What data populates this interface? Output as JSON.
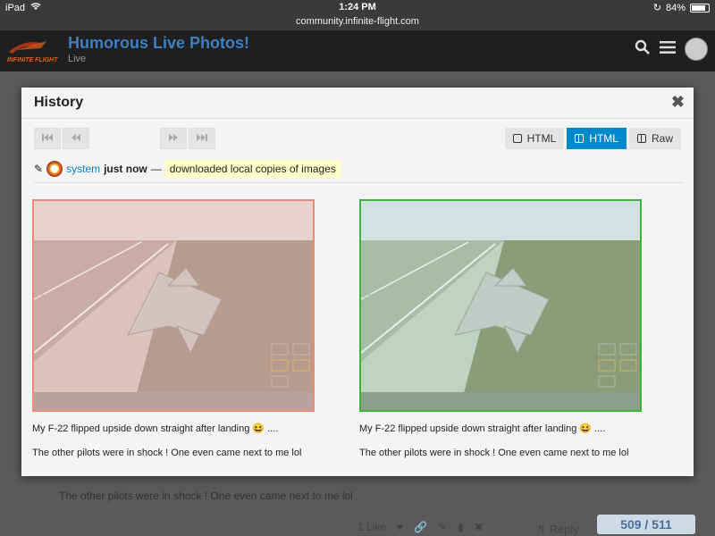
{
  "status_bar": {
    "device": "iPad",
    "time": "1:24 PM",
    "battery": "84%",
    "battery_level": 0.84
  },
  "url": "community.infinite-flight.com",
  "forum": {
    "logo_text": "INFINITE FLIGHT",
    "title": "Humorous Live Photos!",
    "category": "Live"
  },
  "background_post": {
    "text": "The other pilots were in shock ! One even came next to me lol",
    "like_label": "1 Like",
    "reply_label": "Reply",
    "counter": "509 / 511"
  },
  "modal": {
    "title": "History",
    "view_buttons": [
      {
        "label": "HTML",
        "icon": "single-pane-icon",
        "active": false
      },
      {
        "label": "HTML",
        "icon": "split-pane-icon",
        "active": true
      },
      {
        "label": "Raw",
        "icon": "split-pane-icon",
        "active": false
      }
    ],
    "revision": {
      "user": "system",
      "time": "just now",
      "dash": "—",
      "reason": "downloaded local copies of images"
    },
    "left": {
      "line1": "My F-22 flipped upside down straight after landing 😆 ....",
      "line2": "The other pilots were in shock ! One even came next to me lol"
    },
    "right": {
      "line1": "My F-22 flipped upside down straight after landing 😆 ....",
      "line2": "The other pilots were in shock ! One even came next to me lol"
    }
  },
  "colors": {
    "accent": "#0088cc",
    "deleted_border": "#ec8a76",
    "inserted_border": "#3cb53c",
    "highlight": "#ffffc8"
  }
}
